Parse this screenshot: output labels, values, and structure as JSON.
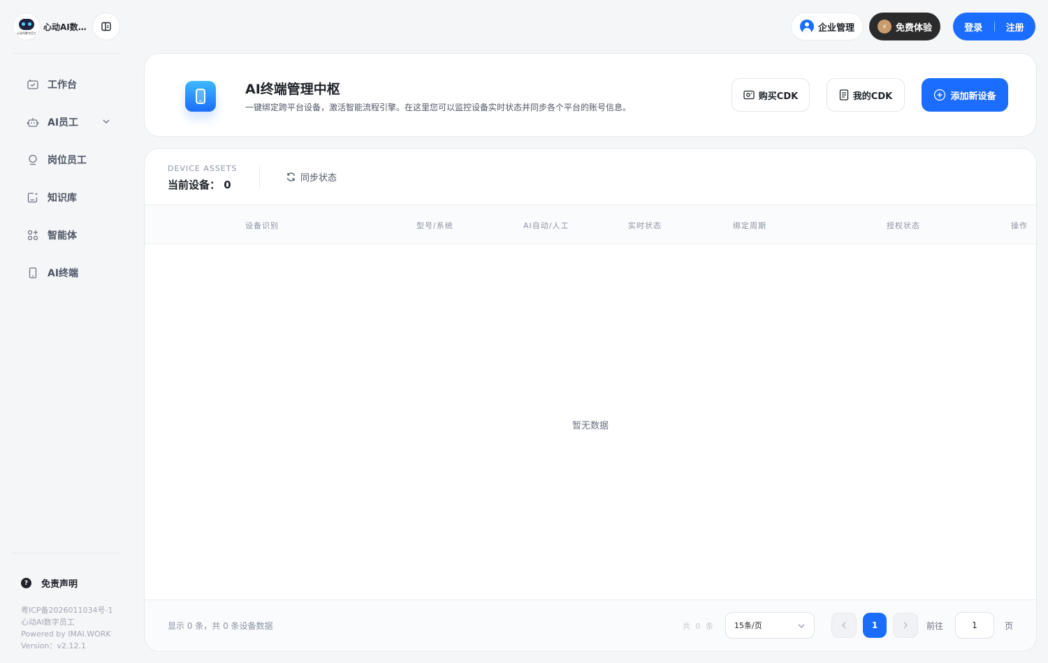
{
  "brand": {
    "name": "心动AI数字员工",
    "logo_text": "心动AI数字员工"
  },
  "sidebar": {
    "items": [
      {
        "label": "工作台",
        "icon": "workbench-icon"
      },
      {
        "label": "AI员工",
        "icon": "robot-icon"
      },
      {
        "label": "岗位员工",
        "icon": "user-icon"
      },
      {
        "label": "知识库",
        "icon": "knowledge-icon"
      },
      {
        "label": "智能体",
        "icon": "agent-icon"
      },
      {
        "label": "AI终端",
        "icon": "device-icon"
      }
    ],
    "disclaimer": "免责声明",
    "footer": {
      "icp": "粤ICP备2026011034号-1",
      "company": "心动AI数字员工",
      "powered": "Powered by IMAI.WORK",
      "version": "Version：v2.12.1"
    }
  },
  "topbar": {
    "enterprise": "企业管理",
    "trial": "免费体验",
    "login": "登录",
    "register": "注册"
  },
  "header": {
    "title": "AI终端管理中枢",
    "subtitle": "一键绑定跨平台设备，激活智能流程引擎。在这里您可以监控设备实时状态并同步各个平台的账号信息。",
    "buy_cdk": "购买CDK",
    "my_cdk": "我的CDK",
    "add_device": "添加新设备"
  },
  "assets": {
    "label": "DEVICE ASSETS",
    "count": "当前设备： 0",
    "sync": "同步状态"
  },
  "table": {
    "columns": [
      "设备识别",
      "型号/系统",
      "AI自动/人工",
      "实时状态",
      "绑定周期",
      "授权状态",
      "操作"
    ],
    "empty": "暂无数据"
  },
  "pagination": {
    "info": "显示 0 条，共 0 条设备数据",
    "total": "共 0 条",
    "page_size": "15条/页",
    "current_page": "1",
    "goto_prefix": "前往",
    "goto_value": "1",
    "goto_suffix": "页"
  },
  "colors": {
    "primary": "#1a6dff",
    "dark": "#2b2b2b",
    "accent": "#c99a6b"
  }
}
